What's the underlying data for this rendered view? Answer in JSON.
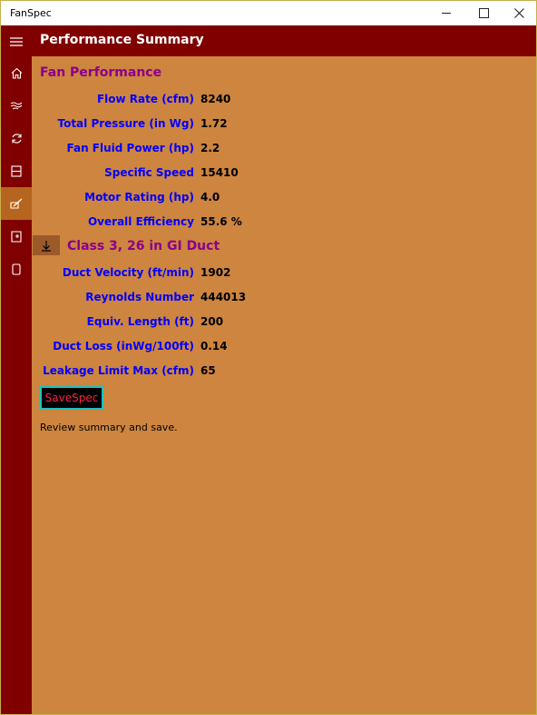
{
  "window": {
    "title": "FanSpec",
    "minimize_icon": "minimize-icon",
    "maximize_icon": "maximize-icon",
    "close_icon": "close-icon"
  },
  "nav": {
    "items": [
      {
        "icon": "hamburger-menu-icon"
      },
      {
        "icon": "home-icon"
      },
      {
        "icon": "airflow-icon"
      },
      {
        "icon": "refresh-icon"
      },
      {
        "icon": "duct-section-icon"
      },
      {
        "icon": "performance-icon",
        "active": true
      },
      {
        "icon": "document-add-icon"
      },
      {
        "icon": "page-icon"
      }
    ],
    "active_color": "#b5651d"
  },
  "header": {
    "title": "Performance Summary"
  },
  "fan_performance": {
    "title": "Fan Performance",
    "rows": [
      {
        "label": "Flow Rate (cfm)",
        "value": "8240"
      },
      {
        "label": "Total Pressure (in Wg)",
        "value": "1.72"
      },
      {
        "label": "Fan Fluid Power (hp)",
        "value": "2.2"
      },
      {
        "label": "Specific Speed",
        "value": "15410"
      },
      {
        "label": "Motor Rating (hp)",
        "value": "4.0"
      },
      {
        "label": "Overall Efficiency",
        "value": "55.6 %"
      }
    ]
  },
  "duct": {
    "title": "Class 3, 26 in GI Duct",
    "collapse_icon": "arrow-down-icon",
    "rows": [
      {
        "label": "Duct Velocity (ft/min)",
        "value": "1902"
      },
      {
        "label": "Reynolds Number",
        "value": "444013"
      },
      {
        "label": "Equiv. Length (ft)",
        "value": "200"
      },
      {
        "label": "Duct Loss (inWg/100ft)",
        "value": "0.14"
      },
      {
        "label": "Leakage Limit Max (cfm)",
        "value": "65"
      }
    ]
  },
  "actions": {
    "save_label": "SaveSpec"
  },
  "status": {
    "text": "Review summary and save."
  },
  "colors": {
    "background": "#cd853f",
    "header": "#800000",
    "section_title": "#8b008b",
    "label": "#0000ff",
    "save_text": "#ff2040",
    "save_border": "#20c0c0"
  }
}
